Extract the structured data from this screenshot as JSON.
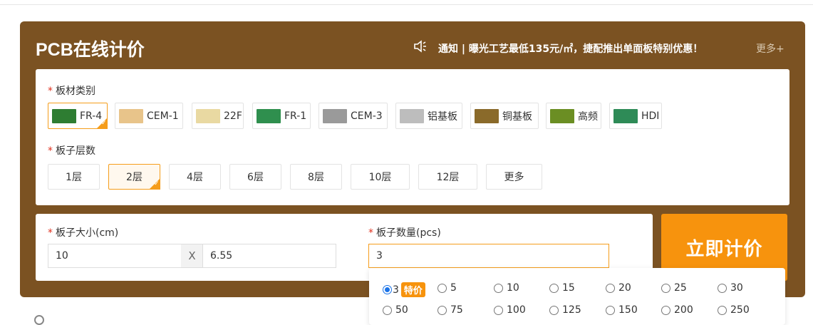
{
  "panel": {
    "title": "PCB在线计价",
    "notice": "通知 | 曝光工艺最低135元/㎡，捷配推出单面板特别优惠！",
    "more": "更多+",
    "speaker_icon": "speaker-icon"
  },
  "material": {
    "label": "板材类别",
    "items": [
      {
        "label": "FR-4",
        "selected": true,
        "thumb_color": "#2e7d32"
      },
      {
        "label": "CEM-1",
        "selected": false,
        "thumb_color": "#e8c48a"
      },
      {
        "label": "22F",
        "selected": false,
        "thumb_color": "#e9d9a2"
      },
      {
        "label": "FR-1",
        "selected": false,
        "thumb_color": "#2f8f4e"
      },
      {
        "label": "CEM-3",
        "selected": false,
        "thumb_color": "#9a9a9a"
      },
      {
        "label": "铝基板",
        "selected": false,
        "thumb_color": "#bdbdbd"
      },
      {
        "label": "铜基板",
        "selected": false,
        "thumb_color": "#8a6a2a"
      },
      {
        "label": "高频",
        "selected": false,
        "thumb_color": "#6b8e23"
      },
      {
        "label": "HDI",
        "selected": false,
        "thumb_color": "#2e8b57"
      }
    ]
  },
  "layers": {
    "label": "板子层数",
    "items": [
      {
        "label": "1层",
        "selected": false
      },
      {
        "label": "2层",
        "selected": true
      },
      {
        "label": "4层",
        "selected": false
      },
      {
        "label": "6层",
        "selected": false
      },
      {
        "label": "8层",
        "selected": false
      },
      {
        "label": "10层",
        "selected": false
      },
      {
        "label": "12层",
        "selected": false
      },
      {
        "label": "更多",
        "selected": false
      }
    ]
  },
  "size": {
    "label": "板子大小(cm)",
    "width": "10",
    "separator": "X",
    "height": "6.55"
  },
  "quantity": {
    "label": "板子数量(pcs)",
    "value": "3",
    "options_row1": [
      "3",
      "5",
      "10",
      "15",
      "20",
      "25",
      "30"
    ],
    "options_row2": [
      "50",
      "75",
      "100",
      "125",
      "150",
      "200",
      "250"
    ],
    "selected": "3",
    "special_badge": "特价"
  },
  "cta": {
    "label": "立即计价"
  },
  "colors": {
    "panel": "#7b5222",
    "accent": "#f7930d",
    "required": "#e0301e"
  }
}
